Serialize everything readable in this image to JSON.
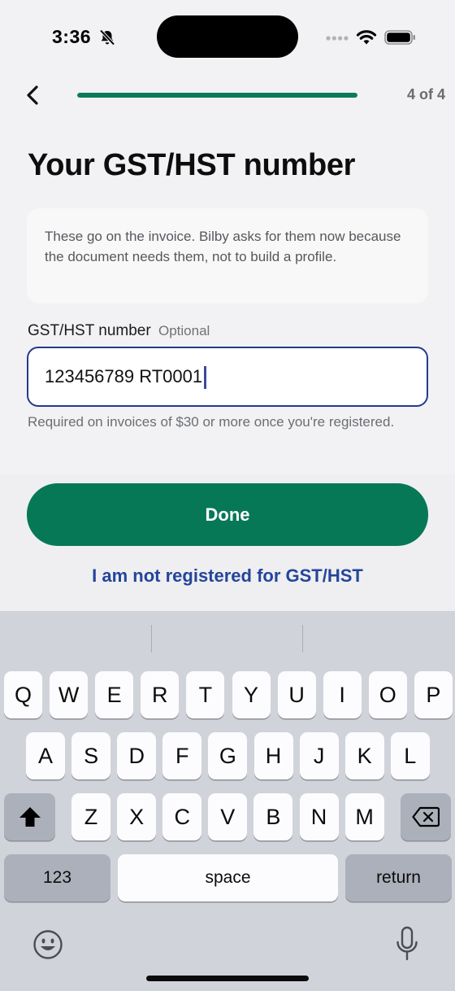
{
  "status_bar": {
    "time": "3:36"
  },
  "nav": {
    "progress_fraction": 1.0,
    "step_label": "4 of 4"
  },
  "page": {
    "title": "Your GST/HST number",
    "info_text": "These go on the invoice. Bilby asks for them now because the document needs them, not to build a profile."
  },
  "gst_field": {
    "label": "GST/HST number",
    "optional_tag": "Optional",
    "value": "123456789 RT0001",
    "hint": "Required on invoices of $30 or more once you're registered."
  },
  "actions": {
    "done_label": "Done",
    "not_registered_label": "I am not registered for GST/HST"
  },
  "keyboard": {
    "row1": [
      "Q",
      "W",
      "E",
      "R",
      "T",
      "Y",
      "U",
      "I",
      "O",
      "P"
    ],
    "row2": [
      "A",
      "S",
      "D",
      "F",
      "G",
      "H",
      "J",
      "K",
      "L"
    ],
    "row3": [
      "Z",
      "X",
      "C",
      "V",
      "B",
      "N",
      "M"
    ],
    "numbers_label": "123",
    "space_label": "space",
    "return_label": "return"
  },
  "colors": {
    "accent_green": "#077856",
    "link_blue": "#24459a",
    "input_border": "#253a8c"
  }
}
